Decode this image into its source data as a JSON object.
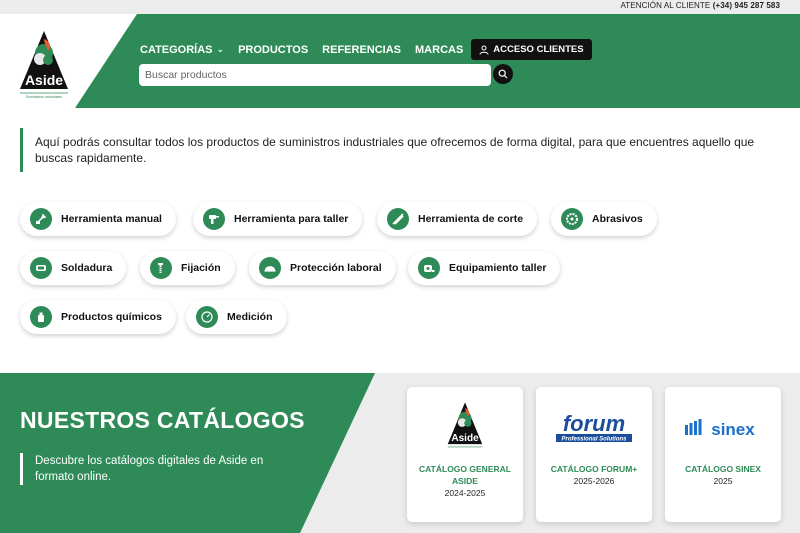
{
  "topbar": {
    "contact_label": "ATENCIÓN AL CLIENTE",
    "phone": "(+34) 945 287 583"
  },
  "brand": {
    "logo_text": "Aside",
    "logo_subtitle": "Suministros Industriales",
    "green": "#2e8b57"
  },
  "nav": {
    "items": [
      "CATEGORÍAS",
      "PRODUCTOS",
      "REFERENCIAS",
      "MARCAS"
    ],
    "access_label": "ACCESO CLIENTES"
  },
  "search": {
    "placeholder": "Buscar productos"
  },
  "intro": {
    "text": "Aquí podrás consultar todos los productos de suministros industriales que ofrecemos de forma digital, para que encuentres aquello que buscas rapidamente."
  },
  "categories": [
    {
      "label": "Herramienta manual",
      "icon": "hand-tool-icon"
    },
    {
      "label": "Herramienta para taller",
      "icon": "drill-icon"
    },
    {
      "label": "Herramienta de corte",
      "icon": "saw-icon"
    },
    {
      "label": "Abrasivos",
      "icon": "disc-icon"
    },
    {
      "label": "Soldadura",
      "icon": "welding-icon"
    },
    {
      "label": "Fijación",
      "icon": "screw-icon"
    },
    {
      "label": "Protección laboral",
      "icon": "helmet-icon"
    },
    {
      "label": "Equipamiento taller",
      "icon": "tape-icon"
    },
    {
      "label": "Productos químicos",
      "icon": "spray-icon"
    },
    {
      "label": "Medición",
      "icon": "gauge-icon"
    }
  ],
  "catalogs": {
    "title": "NUESTROS CATÁLOGOS",
    "description": "Descubre los catálogos digitales de Aside en formato online.",
    "cards": [
      {
        "name": "CATÁLOGO GENERAL ASIDE",
        "years": "2024-2025",
        "logo_text": "Aside"
      },
      {
        "name": "CATÁLOGO FORUM+",
        "years": "2025-2026",
        "logo_text": "forum",
        "logo_sub": "Professional Solutions"
      },
      {
        "name": "CATÁLOGO SINEX",
        "years": "2025",
        "logo_text": "sinex"
      }
    ]
  }
}
